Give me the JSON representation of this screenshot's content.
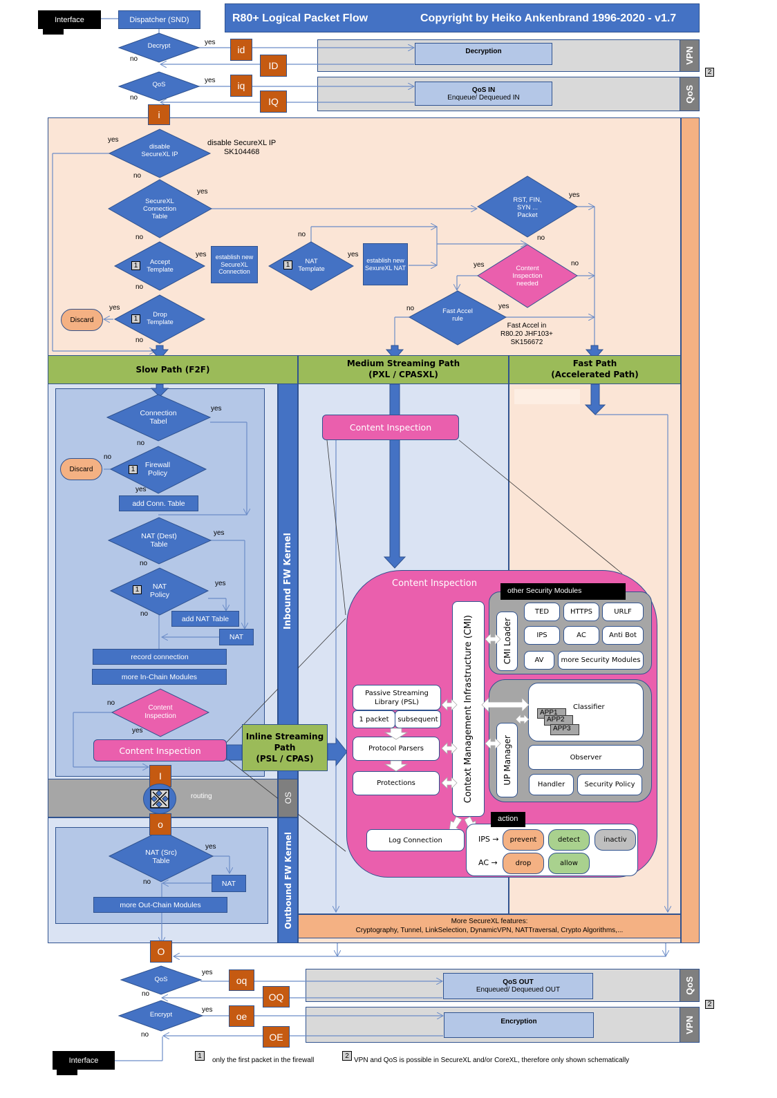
{
  "header": {
    "title": "R80+  Logical Packet Flow",
    "copyright": "Copyright by Heiko Ankenbrand 1996-2020 - v1.7"
  },
  "top": {
    "interface": "Interface",
    "dispatcher": "Dispatcher (SND)",
    "decrypt": "Decrypt",
    "qos": "QoS",
    "yes": "yes",
    "no": "no",
    "id": "id",
    "ID": "ID",
    "iq": "iq",
    "IQ": "IQ",
    "i": "i",
    "decryption": "Decryption",
    "qos_in_title": "QoS IN",
    "qos_in_sub": "Enqueue/ Dequeued IN",
    "vpn_tab": "VPN",
    "qos_tab": "QoS",
    "footnote2": "2"
  },
  "securexl": {
    "disable_ip": "disable SecureXL IP",
    "disable_note_1": "disable SecureXL IP",
    "disable_note_2": "SK104468",
    "conn_table": "SecureXL Connection Table",
    "accept_template": "Accept Template",
    "establish_conn": "establish new SecureXL Connection",
    "nat_template": "NAT Template",
    "establish_nat": "establish new SexureXL NAT",
    "drop_template": "Drop Template",
    "discard": "Discard",
    "rst_packet": "RST, FIN, SYN ... Packet",
    "content_needed": "Content Inspection needed",
    "fast_accel": "Fast Accel rule",
    "fast_accel_note_1": "Fast Accel in",
    "fast_accel_note_2": "R80.20 JHF103+",
    "fast_accel_note_3": "SK156672",
    "footnote1": "1"
  },
  "paths": {
    "slow": "Slow Path (F2F)",
    "medium_1": "Medium Streaming Path",
    "medium_2": "(PXL / CPASXL)",
    "fast_1": "Fast Path",
    "fast_2": "(Accelerated Path)"
  },
  "inbound": {
    "kernel_label": "Inbound FW Kernel",
    "conn_tabel": "Connection Tabel",
    "firewall_policy": "Firewall Policy",
    "discard": "Discard",
    "add_conn": "add Conn. Table",
    "nat_dest": "NAT (Dest) Table",
    "nat_policy": "NAT Policy",
    "add_nat": "add NAT Table",
    "nat": "NAT",
    "record": "record connection",
    "more_in": "more In-Chain Modules",
    "ci_decision": "Content Inspection",
    "ci_box": "Content Inspection",
    "I": "I"
  },
  "inline": {
    "line1": "Inline Streaming",
    "line2": "Path",
    "line3": "(PSL / CPAS)"
  },
  "os": {
    "label": "OS",
    "routing": "routing",
    "o": "o"
  },
  "outbound": {
    "kernel_label": "Outbound FW Kernel",
    "nat_src": "NAT (Src) Table",
    "nat": "NAT",
    "more_out": "more Out-Chain Modules",
    "O": "O"
  },
  "medium": {
    "ci_box": "Content Inspection"
  },
  "ci": {
    "title": "Content Inspection",
    "cmi": "Context Management Infrastructure (CMI)",
    "other_modules": "other Security Modules",
    "cmi_loader": "CMI Loader",
    "modules": [
      "TED",
      "HTTPS",
      "URLF",
      "IPS",
      "AC",
      "Anti Bot",
      "AV",
      "more Security Modules"
    ],
    "psl": "Passive Streaming Library (PSL)",
    "one_packet": "1 packet",
    "subsequent": "subsequent",
    "protocol_parsers": "Protocol Parsers",
    "protections": "Protections",
    "up_manager": "UP Manager",
    "classifier": "Classifier",
    "apps": [
      "APP1",
      "APP2",
      "APP3"
    ],
    "observer": "Observer",
    "handler": "Handler",
    "security_policy": "Security Policy",
    "log_connection": "Log Connection",
    "action": "action",
    "ips": "IPS →",
    "ac": "AC →",
    "prevent": "prevent",
    "detect": "detect",
    "inactiv": "inactiv",
    "drop": "drop",
    "allow": "allow"
  },
  "more_securexl": {
    "line1": "More SecureXL features:",
    "line2": "Cryptography, Tunnel, LinkSelection, DynamicVPN, NATTraversal, Crypto Algorithms,..."
  },
  "bottom": {
    "qos": "QoS",
    "encrypt": "Encrypt",
    "yes": "yes",
    "no": "no",
    "oq": "oq",
    "OQ": "OQ",
    "oe": "oe",
    "OE": "OE",
    "qos_out_title": "QoS OUT",
    "qos_out_sub": "Enqueued/ Dequeued OUT",
    "encryption": "Encryption",
    "qos_tab": "QoS",
    "vpn_tab": "VPN",
    "interface": "Interface",
    "footnote2": "2"
  },
  "legend": {
    "n1": "1",
    "t1": "only the first packet in the firewall",
    "n2": "2",
    "t2": "VPN and QoS is possible in SecureXL and/or CoreXL, therefore only shown schematically"
  },
  "colors": {
    "blue": "#4472c4",
    "orange": "#c55a11",
    "pink": "#ea5fad",
    "green": "#9bbb59",
    "peach": "#fbe5d6",
    "salmon": "#f4b183",
    "light_blue": "#b4c7e7",
    "pale_blue": "#dae3f3",
    "grey": "#d9d9d9"
  }
}
